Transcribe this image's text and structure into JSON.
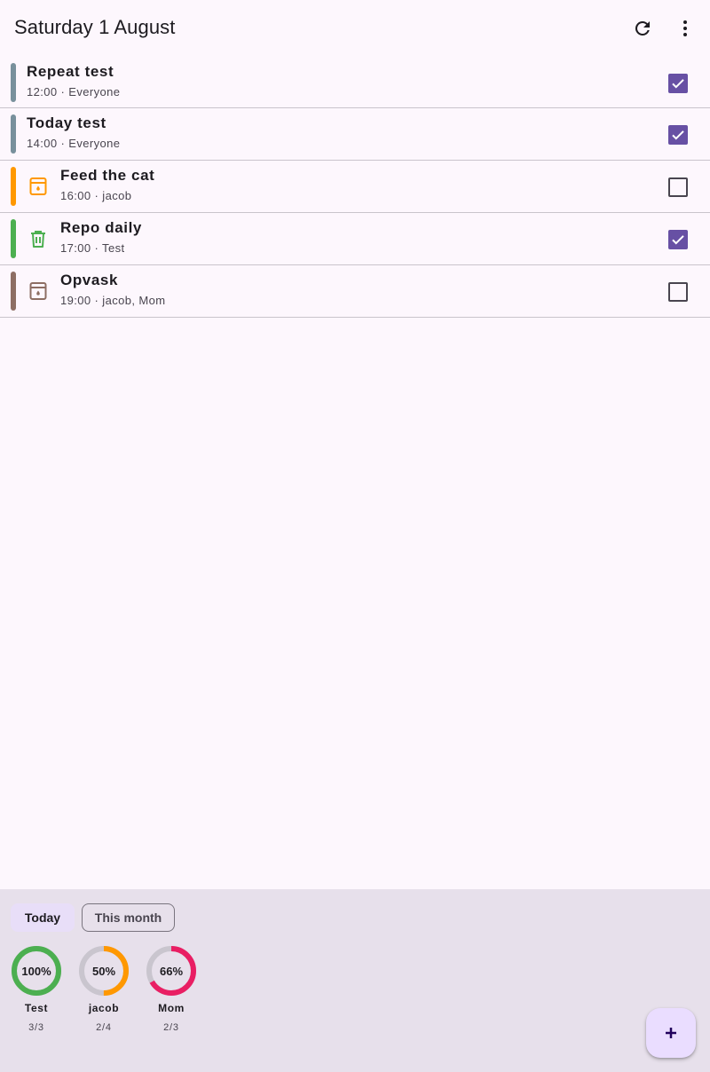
{
  "header": {
    "title": "Saturday 1 August",
    "refresh_icon": "refresh-icon",
    "more_icon": "more-vert-icon"
  },
  "tasks": [
    {
      "title": "Repeat test",
      "subtitle": "12:00 · Everyone",
      "color": "#78909c",
      "icon": "",
      "checked": true
    },
    {
      "title": "Today test",
      "subtitle": "14:00 · Everyone",
      "color": "#78909c",
      "icon": "",
      "checked": true
    },
    {
      "title": "Feed the cat",
      "subtitle": "16:00 · jacob",
      "color": "#ff9800",
      "icon": "dishwasher-icon",
      "checked": false
    },
    {
      "title": "Repo daily",
      "subtitle": "17:00 · Test",
      "color": "#4caf50",
      "icon": "trash-icon",
      "checked": true
    },
    {
      "title": "Opvask",
      "subtitle": "19:00 · jacob, Mom",
      "color": "#8d6e63",
      "icon": "dishwasher-icon",
      "checked": false
    }
  ],
  "filters": {
    "today": "Today",
    "this_month": "This month",
    "selected": "Today"
  },
  "stats": [
    {
      "name": "Test",
      "percent_label": "100%",
      "count": "3/3",
      "fraction": 1.0,
      "color": "#4caf50"
    },
    {
      "name": "jacob",
      "percent_label": "50%",
      "count": "2/4",
      "fraction": 0.5,
      "color": "#ff9800"
    },
    {
      "name": "Mom",
      "percent_label": "66%",
      "count": "2/3",
      "fraction": 0.667,
      "color": "#e91e63"
    }
  ],
  "colors": {
    "background": "#fdf7fd",
    "panel": "#e7e0eb",
    "accent": "#6750a4",
    "track": "#c9c5ce"
  },
  "fab_icon": "add-icon"
}
